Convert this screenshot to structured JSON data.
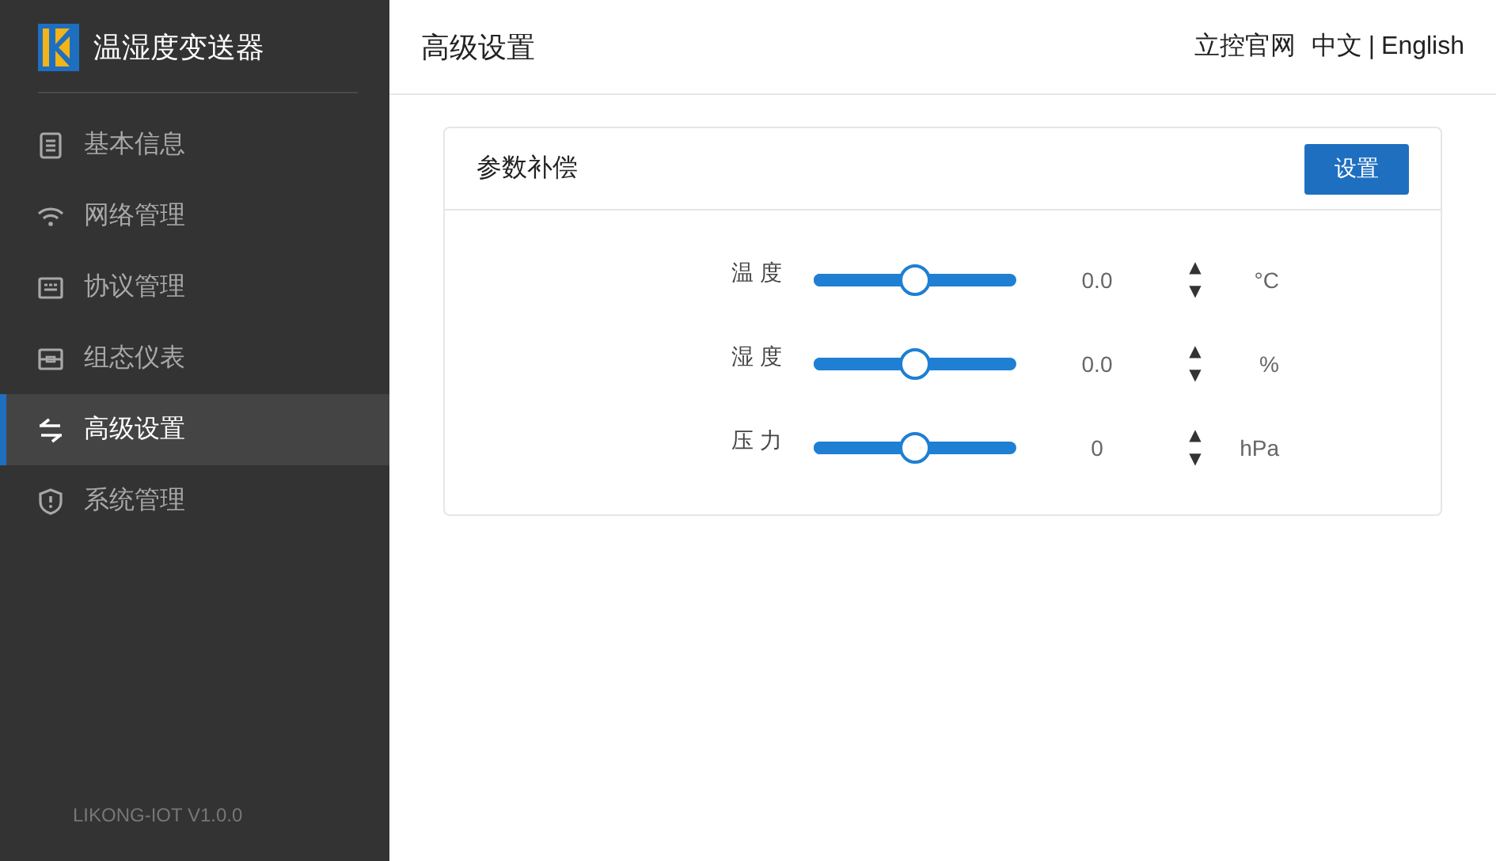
{
  "sidebar": {
    "title": "温湿度变送器",
    "items": [
      {
        "label": "基本信息",
        "kind": "document",
        "selected": false
      },
      {
        "label": "网络管理",
        "kind": "wifi",
        "selected": false
      },
      {
        "label": "协议管理",
        "kind": "keyboard",
        "selected": false
      },
      {
        "label": "组态仪表",
        "kind": "meter",
        "selected": false
      },
      {
        "label": "高级设置",
        "kind": "swap",
        "selected": true
      },
      {
        "label": "系统管理",
        "kind": "shield",
        "selected": false
      }
    ],
    "version": "LIKONG-IOT V1.0.0"
  },
  "header": {
    "title": "高级设置",
    "site_link": "立控官网",
    "languages": [
      "中文",
      "English"
    ],
    "separator": "|"
  },
  "card": {
    "title": "参数补偿",
    "button": "设置",
    "rows": [
      {
        "label": "温 度",
        "level": 0.5,
        "value": "0.0",
        "up": "▲",
        "down": "▼",
        "unit": "°C"
      },
      {
        "label": "湿 度",
        "level": 0.5,
        "value": "0.0",
        "up": "▲",
        "down": "▼",
        "unit": "%"
      },
      {
        "label": "压 力",
        "level": 0.5,
        "value": "0",
        "up": "▲",
        "down": "▼",
        "unit": "hPa"
      }
    ]
  }
}
